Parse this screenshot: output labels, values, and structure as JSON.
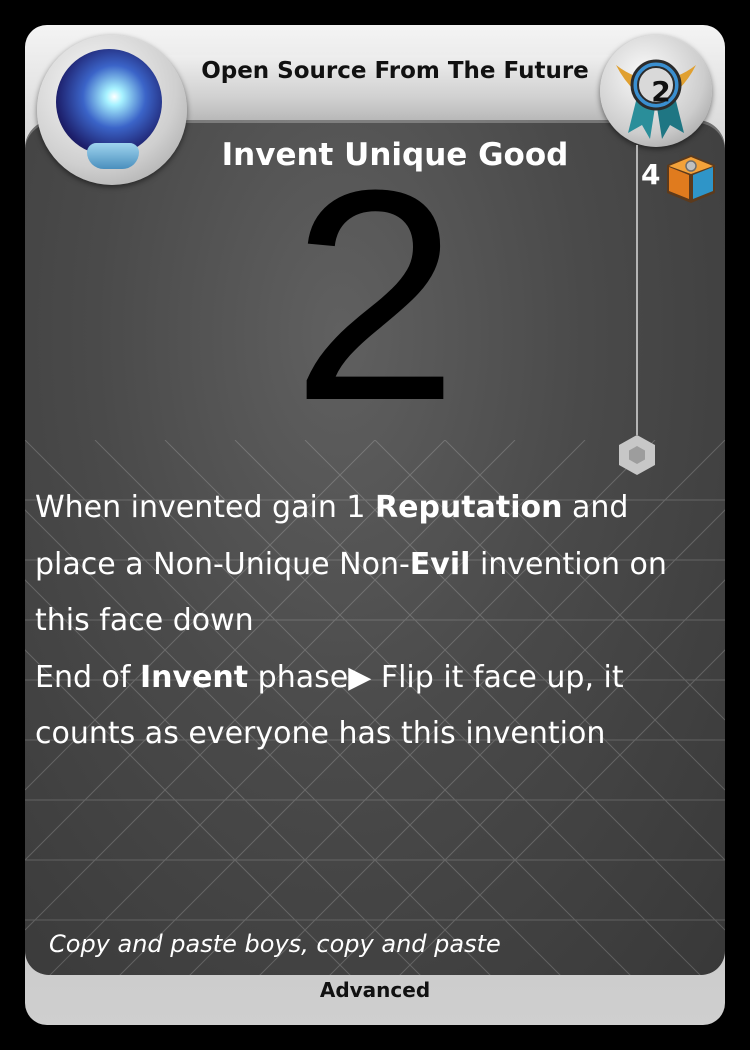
{
  "card": {
    "name": "Open Source From The Future",
    "title": "Invent Unique Good",
    "big_number": "2",
    "level": "2",
    "cost": "4",
    "rules": {
      "line1_a": "When invented gain 1 ",
      "line1_b": "Reputation",
      "line1_c": " and place a Non-Unique Non-",
      "line1_d": "Evil",
      "line1_e": " invention on this face down",
      "line2_a": "End of ",
      "line2_b": "Invent",
      "line2_c": " phase",
      "line2_arrow": "▶",
      "line2_d": " Flip it face up, it counts as everyone has this invention"
    },
    "flavor": "Copy and paste boys, copy and paste",
    "footer": "Advanced",
    "icons": {
      "orb": "crystal-ball-icon",
      "medal": "level-medal-icon",
      "box": "crate-icon",
      "hex": "hexagon-icon"
    },
    "colors": {
      "panel": "#4a4a4a",
      "rule_text": "#ffffff",
      "frame": "#cfcfcf"
    }
  }
}
